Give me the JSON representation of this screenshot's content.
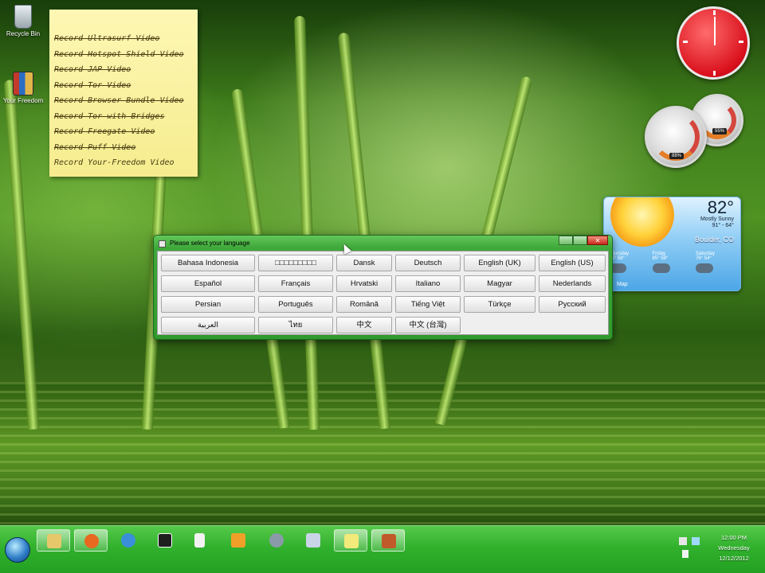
{
  "desktop": {
    "icons": [
      {
        "label": "Recycle Bin",
        "icon": "recycle-bin-icon"
      },
      {
        "label": "Your Freedom",
        "icon": "your-freedom-icon"
      }
    ]
  },
  "sticky_note": {
    "items": [
      {
        "text": "Record Ultrasurf Video",
        "done": true
      },
      {
        "text": "Record Hotspot Shield Video",
        "done": true
      },
      {
        "text": "Record JAP Video",
        "done": true
      },
      {
        "text": "Record Tor Video",
        "done": true
      },
      {
        "text": "Record Browser Bundle Video",
        "done": true
      },
      {
        "text": "Record Tor with Bridges",
        "done": true
      },
      {
        "text": "Record Freegate Video",
        "done": true
      },
      {
        "text": "Record Puff Video",
        "done": true
      },
      {
        "text": "Record Your-Freedom Video",
        "done": false
      }
    ]
  },
  "gadgets": {
    "cpu_meter": {
      "readout_left": "88%",
      "readout_right": "55%"
    },
    "weather": {
      "temperature": "82°",
      "condition": "Mostly Sunny",
      "range": "91° - 64°",
      "city": "Boulder, CO",
      "days": [
        {
          "name": "Thursday",
          "temps": "85°  58°"
        },
        {
          "name": "Friday",
          "temps": "85°  58°"
        },
        {
          "name": "Saturday",
          "temps": "76°  54°"
        }
      ],
      "link": "Map"
    }
  },
  "dialog": {
    "title": "Please select your language",
    "languages": [
      "Bahasa Indonesia",
      "□□□□□□□□□",
      "Dansk",
      "Deutsch",
      "English (UK)",
      "English (US)",
      "Español",
      "Français",
      "Hrvatski",
      "Italiano",
      "Magyar",
      "Nederlands",
      "Persian",
      "Português",
      "Română",
      "Tiếng Việt",
      "Türkçe",
      "Русский",
      "العربية",
      "ไทย",
      "中文",
      "中文 (台灣)"
    ]
  },
  "taskbar": {
    "time": "12:00 PM",
    "day": "Wednesday",
    "date": "12/12/2012",
    "items": [
      {
        "icon": "folder-icon",
        "color": "#e6c86a",
        "active": true
      },
      {
        "icon": "firefox-icon",
        "color": "#e8691f",
        "active": true
      },
      {
        "icon": "internet-explorer-icon",
        "color": "#3a8fd8",
        "active": false
      },
      {
        "icon": "7zip-icon",
        "color": "#1e1e1e",
        "active": false
      },
      {
        "icon": "solitaire-icon",
        "color": "#f2f2f2",
        "active": false
      },
      {
        "icon": "media-player-icon",
        "color": "#f0a028",
        "active": false
      },
      {
        "icon": "globe-icon",
        "color": "#8a9aa8",
        "active": false
      },
      {
        "icon": "remote-desktop-icon",
        "color": "#c9d4e6",
        "active": false
      },
      {
        "icon": "sticky-notes-icon",
        "color": "#f2ea7a",
        "active": true
      },
      {
        "icon": "your-freedom-icon",
        "color": "#c05a2a",
        "active": true
      }
    ]
  },
  "colors": {
    "taskbar": "#31b12d",
    "dialog_frame": "#3ea83a",
    "sticky_note": "#fdf7b4",
    "clock_face": "#d9101c"
  }
}
